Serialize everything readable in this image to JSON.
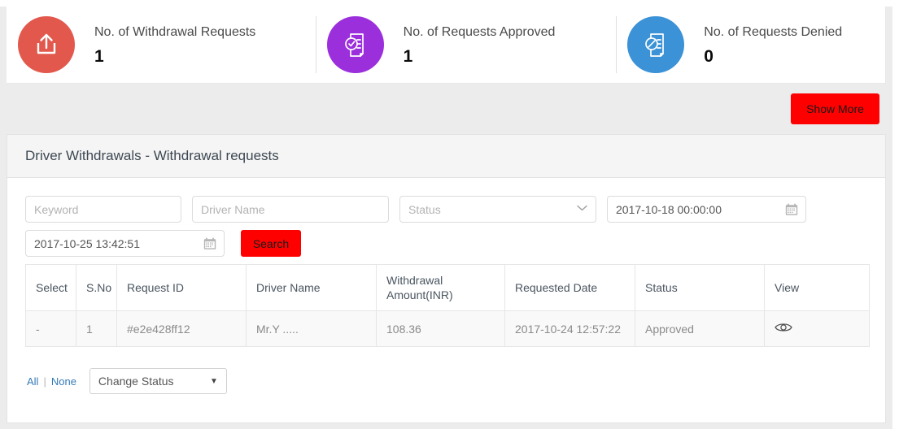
{
  "stats": [
    {
      "label": "No. of Withdrawal Requests",
      "value": "1",
      "color": "#e2584d",
      "icon": "upload-icon"
    },
    {
      "label": "No. of Requests Approved",
      "value": "1",
      "color": "#9b2fdc",
      "icon": "document-approved-icon"
    },
    {
      "label": "No. of Requests Denied",
      "value": "0",
      "color": "#3b92d6",
      "icon": "document-denied-icon"
    }
  ],
  "toolbar": {
    "show_more_label": "Show More",
    "show_more_color": "#ff0000"
  },
  "panel": {
    "title": "Driver Withdrawals - Withdrawal requests"
  },
  "filters": {
    "keyword_placeholder": "Keyword",
    "keyword_value": "",
    "driver_name_placeholder": "Driver Name",
    "driver_name_value": "",
    "status_label": "Status",
    "date_from": "2017-10-18 00:00:00",
    "date_to": "2017-10-25 13:42:51",
    "search_label": "Search"
  },
  "table": {
    "headers": [
      "Select",
      "S.No",
      "Request ID",
      "Driver Name",
      "Withdrawal Amount(INR)",
      "Requested Date",
      "Status",
      "View"
    ],
    "rows": [
      {
        "select": "-",
        "sno": "1",
        "request_id": "#e2e428ff12",
        "driver_name": "Mr.Y .....",
        "amount": "108.36",
        "requested_date": "2017-10-24 12:57:22",
        "status": "Approved",
        "status_color": "#5cb85c",
        "view_icon": "eye-icon"
      }
    ]
  },
  "footer": {
    "select_all_label": "All",
    "separator": "|",
    "select_none_label": "None",
    "change_status_label": "Change Status"
  }
}
